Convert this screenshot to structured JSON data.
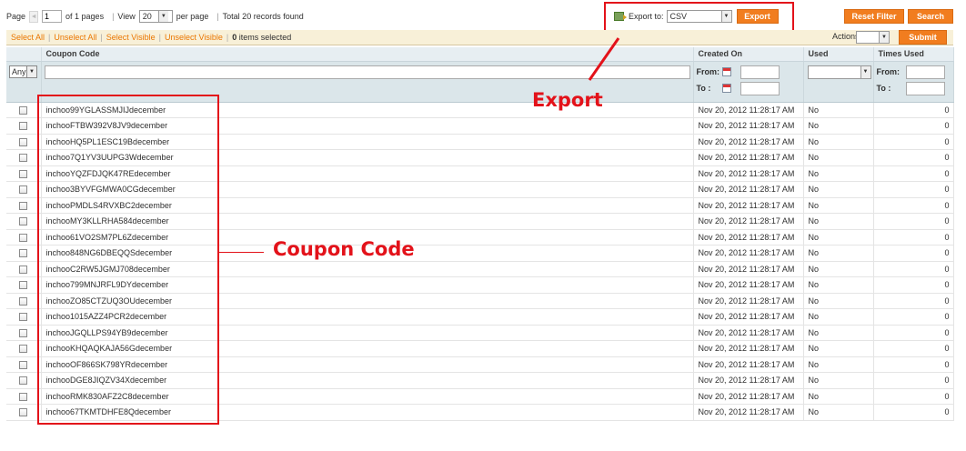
{
  "pager": {
    "page_label": "Page",
    "prev_arrow": "◄",
    "page_value": "1",
    "of_pages": "of 1 pages",
    "view_label": "View",
    "per_page_value": "20",
    "per_page_label": "per page",
    "total": "Total 20 records found"
  },
  "export": {
    "label": "Export to:",
    "format": "CSV",
    "button": "Export"
  },
  "filter_buttons": {
    "reset": "Reset Filter",
    "search": "Search"
  },
  "massaction": {
    "select_all": "Select All",
    "unselect_all": "Unselect All",
    "select_visible": "Select Visible",
    "unselect_visible": "Unselect Visible",
    "selected_count": "0",
    "selected_suffix": "items selected",
    "actions_label": "Actions",
    "submit": "Submit"
  },
  "grid": {
    "columns": [
      "Coupon Code",
      "Created On",
      "Used",
      "Times Used"
    ],
    "filters": {
      "massaction_any": "Any",
      "from_label": "From:",
      "to_label": "To :"
    },
    "rows": [
      {
        "code": "inchoo99YGLASSMJIJdecember",
        "created": "Nov 20, 2012 11:28:17 AM",
        "used": "No",
        "times": "0"
      },
      {
        "code": "inchooFTBW392V8JV9december",
        "created": "Nov 20, 2012 11:28:17 AM",
        "used": "No",
        "times": "0"
      },
      {
        "code": "inchooHQ5PL1ESC19Bdecember",
        "created": "Nov 20, 2012 11:28:17 AM",
        "used": "No",
        "times": "0"
      },
      {
        "code": "inchoo7Q1YV3UUPG3Wdecember",
        "created": "Nov 20, 2012 11:28:17 AM",
        "used": "No",
        "times": "0"
      },
      {
        "code": "inchooYQZFDJQK47REdecember",
        "created": "Nov 20, 2012 11:28:17 AM",
        "used": "No",
        "times": "0"
      },
      {
        "code": "inchoo3BYVFGMWA0CGdecember",
        "created": "Nov 20, 2012 11:28:17 AM",
        "used": "No",
        "times": "0"
      },
      {
        "code": "inchooPMDLS4RVXBC2december",
        "created": "Nov 20, 2012 11:28:17 AM",
        "used": "No",
        "times": "0"
      },
      {
        "code": "inchooMY3KLLRHA584december",
        "created": "Nov 20, 2012 11:28:17 AM",
        "used": "No",
        "times": "0"
      },
      {
        "code": "inchoo61VO2SM7PL6Zdecember",
        "created": "Nov 20, 2012 11:28:17 AM",
        "used": "No",
        "times": "0"
      },
      {
        "code": "inchoo848NG6DBEQQSdecember",
        "created": "Nov 20, 2012 11:28:17 AM",
        "used": "No",
        "times": "0"
      },
      {
        "code": "inchooC2RW5JGMJ708december",
        "created": "Nov 20, 2012 11:28:17 AM",
        "used": "No",
        "times": "0"
      },
      {
        "code": "inchoo799MNJRFL9DYdecember",
        "created": "Nov 20, 2012 11:28:17 AM",
        "used": "No",
        "times": "0"
      },
      {
        "code": "inchooZO85CTZUQ3OUdecember",
        "created": "Nov 20, 2012 11:28:17 AM",
        "used": "No",
        "times": "0"
      },
      {
        "code": "inchoo1015AZZ4PCR2december",
        "created": "Nov 20, 2012 11:28:17 AM",
        "used": "No",
        "times": "0"
      },
      {
        "code": "inchooJGQLLPS94YB9december",
        "created": "Nov 20, 2012 11:28:17 AM",
        "used": "No",
        "times": "0"
      },
      {
        "code": "inchooKHQAQKAJA56Gdecember",
        "created": "Nov 20, 2012 11:28:17 AM",
        "used": "No",
        "times": "0"
      },
      {
        "code": "inchooOF866SK798YRdecember",
        "created": "Nov 20, 2012 11:28:17 AM",
        "used": "No",
        "times": "0"
      },
      {
        "code": "inchooDGE8JIQZV34Xdecember",
        "created": "Nov 20, 2012 11:28:17 AM",
        "used": "No",
        "times": "0"
      },
      {
        "code": "inchooRMK830AFZ2C8december",
        "created": "Nov 20, 2012 11:28:17 AM",
        "used": "No",
        "times": "0"
      },
      {
        "code": "inchoo67TKMTDHFE8Qdecember",
        "created": "Nov 20, 2012 11:28:17 AM",
        "used": "No",
        "times": "0"
      }
    ]
  },
  "annotations": {
    "export": "Export",
    "coupon_code": "Coupon Code"
  },
  "colors": {
    "accent_orange": "#f17d1f",
    "annotation_red": "#e3121a",
    "header_bg": "#e7eef2",
    "filter_bg": "#dbe6ea"
  },
  "icons": [
    "export-icon",
    "calendar-icon",
    "checkbox-icon",
    "dropdown-arrow-icon"
  ]
}
